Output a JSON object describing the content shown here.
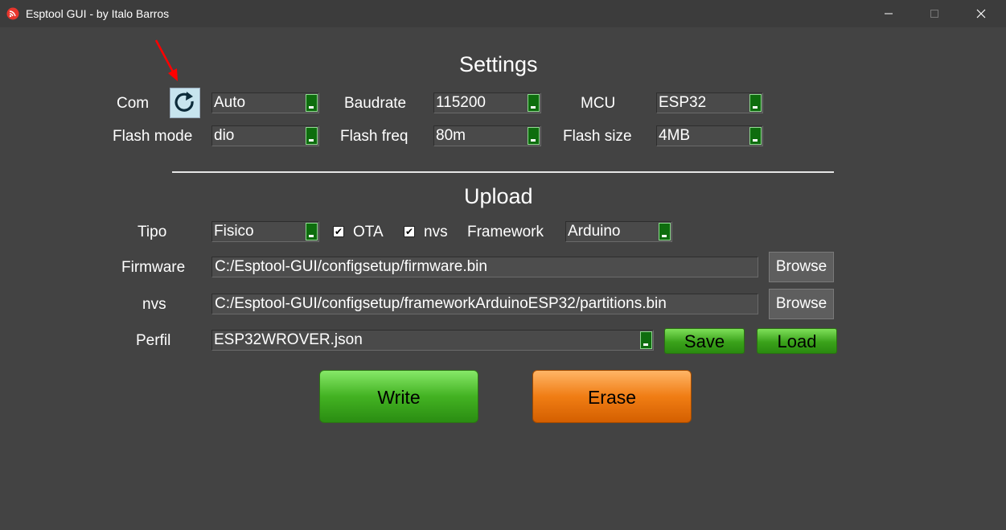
{
  "window": {
    "title": "Esptool GUI - by Italo Barros",
    "minimize_glyph": "—",
    "maximize_glyph": "☐",
    "close_glyph": "✕"
  },
  "settings": {
    "heading": "Settings",
    "com_label": "Com",
    "refresh_icon": "refresh-icon",
    "com_value": "Auto",
    "baudrate_label": "Baudrate",
    "baudrate_value": "115200",
    "mcu_label": "MCU",
    "mcu_value": "ESP32",
    "flash_mode_label": "Flash mode",
    "flash_mode_value": "dio",
    "flash_freq_label": "Flash freq",
    "flash_freq_value": "80m",
    "flash_size_label": "Flash size",
    "flash_size_value": "4MB"
  },
  "upload": {
    "heading": "Upload",
    "tipo_label": "Tipo",
    "tipo_value": "Fisico",
    "ota_label": "OTA",
    "ota_checked": true,
    "nvs_check_label": "nvs",
    "nvs_checked": true,
    "framework_label": "Framework",
    "framework_value": "Arduino",
    "firmware_label": "Firmware",
    "firmware_path": "C:/Esptool-GUI/configsetup/firmware.bin",
    "firmware_browse": "Browse",
    "nvs_label": "nvs",
    "nvs_path": "C:/Esptool-GUI/configsetup/frameworkArduinoESP32/partitions.bin",
    "nvs_browse": "Browse",
    "perfil_label": "Perfil",
    "perfil_value": "ESP32WROVER.json",
    "save_label": "Save",
    "load_label": "Load"
  },
  "actions": {
    "write_label": "Write",
    "erase_label": "Erase"
  },
  "colors": {
    "background": "#434343",
    "titlebar": "#3c3c3c",
    "dropdown_arrow": "#0e6d0e",
    "green_button": "#43b222",
    "orange_button": "#f07d14",
    "annotation_arrow": "#ff0000"
  }
}
